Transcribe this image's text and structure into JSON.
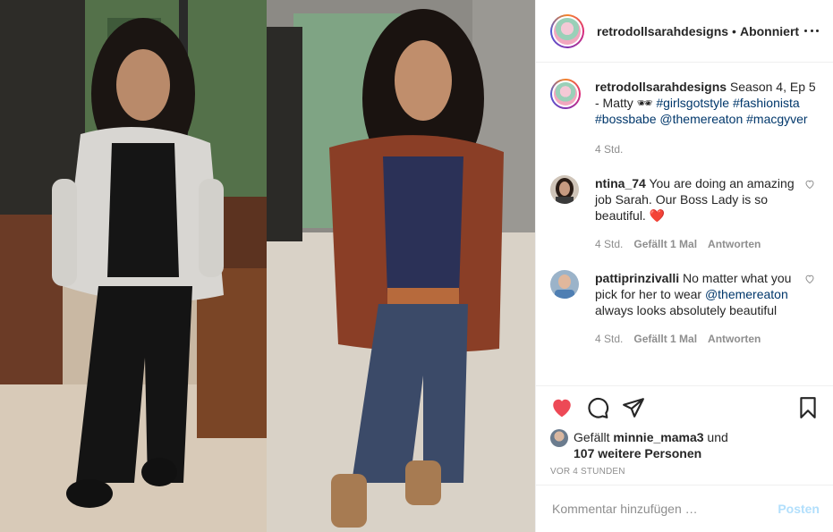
{
  "post": {
    "username": "retrodollsarahdesigns",
    "separator": "•",
    "follow_status": "Abonniert",
    "more_label": "•••"
  },
  "caption": {
    "username": "retrodollsarahdesigns",
    "text_before": " Season 4, Ep 5 - Matty ",
    "emoji": "🕶",
    "tag1": "#girlsgotstyle",
    "tag2": "#fashionista",
    "tag3": "#bossbabe",
    "mention": "@themereaton",
    "tag4": "#macgyver",
    "time": "4 Std."
  },
  "comments": [
    {
      "username": "ntina_74",
      "text": " You are doing an amazing job Sarah. Our Boss Lady is so beautiful. ",
      "emoji": "❤️",
      "time": "4 Std.",
      "likes": "Gefällt 1 Mal",
      "reply": "Antworten"
    },
    {
      "username": "pattiprinzivalli",
      "text_before": " No matter what you pick for her to wear ",
      "mention": "@themereaton",
      "text_after": " always looks absolutely beautiful",
      "time": "4 Std.",
      "likes": "Gefällt 1 Mal",
      "reply": "Antworten"
    }
  ],
  "likes": {
    "prefix": "Gefällt ",
    "user": "minnie_mama3",
    "middle": " und",
    "count_text": "107 weitere Personen"
  },
  "timestamp": "Vor 4 Stunden",
  "composer": {
    "placeholder": "Kommentar hinzufügen …",
    "post_label": "Posten"
  },
  "colors": {
    "like_red": "#ed4956",
    "link_blue": "#00376b",
    "post_disabled": "#b2dffc"
  }
}
